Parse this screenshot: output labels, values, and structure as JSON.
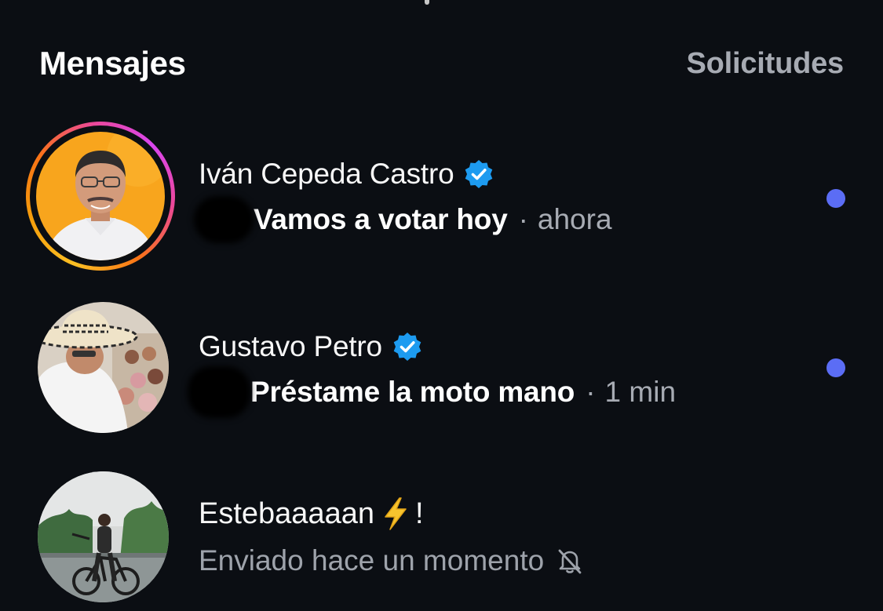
{
  "header": {
    "title": "Mensajes",
    "requests_label": "Solicitudes"
  },
  "threads": [
    {
      "name": "Iván Cepeda Castro",
      "verified": true,
      "message": "Vamos a votar hoy",
      "separator": "·",
      "time": "ahora",
      "unread": true,
      "has_story_ring": true
    },
    {
      "name": "Gustavo Petro",
      "verified": true,
      "message": "Préstame la moto mano",
      "separator": "·",
      "time": "1 min",
      "unread": true,
      "has_story_ring": false
    },
    {
      "name_before_emoji": "Estebaaaaan",
      "emoji": "⚡",
      "name_after_emoji": "!",
      "status": "Enviado hace un momento",
      "muted": true
    }
  ],
  "colors": {
    "background": "#0b0e13",
    "text_primary": "#f7f7f7",
    "text_secondary": "#a7abb3",
    "unread_dot": "#5b6df5",
    "verified_badge": "#1d9bf0"
  },
  "icons": {
    "verified": "verified-badge-icon",
    "bolt": "high-voltage-emoji-icon",
    "muted": "bell-slash-icon"
  }
}
